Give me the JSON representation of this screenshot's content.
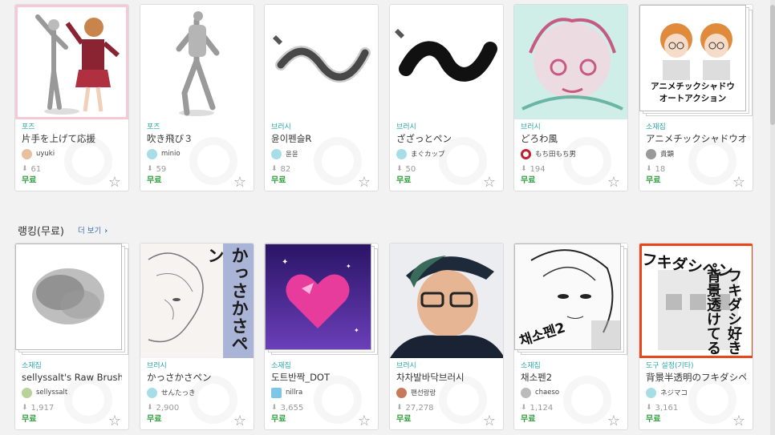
{
  "section": {
    "title": "랭킹(무료)",
    "more": "더 보기",
    "more_icon": "chevron-right"
  },
  "row1": [
    {
      "cat": "포즈",
      "title": "片手を上げて応援",
      "author": "uyuki",
      "downloads": "61",
      "price": "무료"
    },
    {
      "cat": "포즈",
      "title": "吹き飛び３",
      "author": "minio",
      "downloads": "59",
      "price": "무료"
    },
    {
      "cat": "브러시",
      "title": "윤이펜슬R",
      "author": "윤윤",
      "downloads": "82",
      "price": "무료"
    },
    {
      "cat": "브러시",
      "title": "ざざっとペン",
      "author": "まぐカップ",
      "downloads": "50",
      "price": "무료"
    },
    {
      "cat": "브러시",
      "title": "どろわ風",
      "author": "もち田もち男",
      "downloads": "194",
      "price": "무료"
    },
    {
      "cat": "소재집",
      "title": "アニメチックシャドウオ",
      "author": "貴顕",
      "downloads": "18",
      "price": "무료",
      "thumb_text": [
        "アニメチックシャドウ",
        "オートアクション"
      ]
    }
  ],
  "row2": [
    {
      "cat": "소재집",
      "title": "sellyssalt's Raw Brush",
      "author": "sellyssalt",
      "downloads": "1,917",
      "price": "무료"
    },
    {
      "cat": "브러시",
      "title": "かっさかさペン",
      "author": "せんたっき",
      "downloads": "2,900",
      "price": "무료",
      "thumb_text": "かっさかさペン"
    },
    {
      "cat": "소재집",
      "title": "도트반짝_DOT",
      "author": "nillra",
      "downloads": "3,655",
      "price": "무료"
    },
    {
      "cat": "브러시",
      "title": "차차발바닥브러시",
      "author": "팬선랑랑",
      "downloads": "27,278",
      "price": "무료"
    },
    {
      "cat": "소재집",
      "title": "채소펜2",
      "author": "chaeso",
      "downloads": "1,124",
      "price": "무료",
      "thumb_text": "채소펜2"
    },
    {
      "cat": "도구 설정(기타)",
      "title": "背景半透明のフキダシペ",
      "author": "ネジマコ",
      "downloads": "3,161",
      "price": "무료",
      "thumb_text": [
        "フキダシペン",
        "背景透けてる",
        "フキダシ好き"
      ]
    }
  ],
  "icons": {
    "download": "download-icon",
    "favorite": "star-icon"
  },
  "colors": {
    "category": "#2aa6a6",
    "price": "#2e9c3a",
    "link": "#3b6fb6"
  }
}
